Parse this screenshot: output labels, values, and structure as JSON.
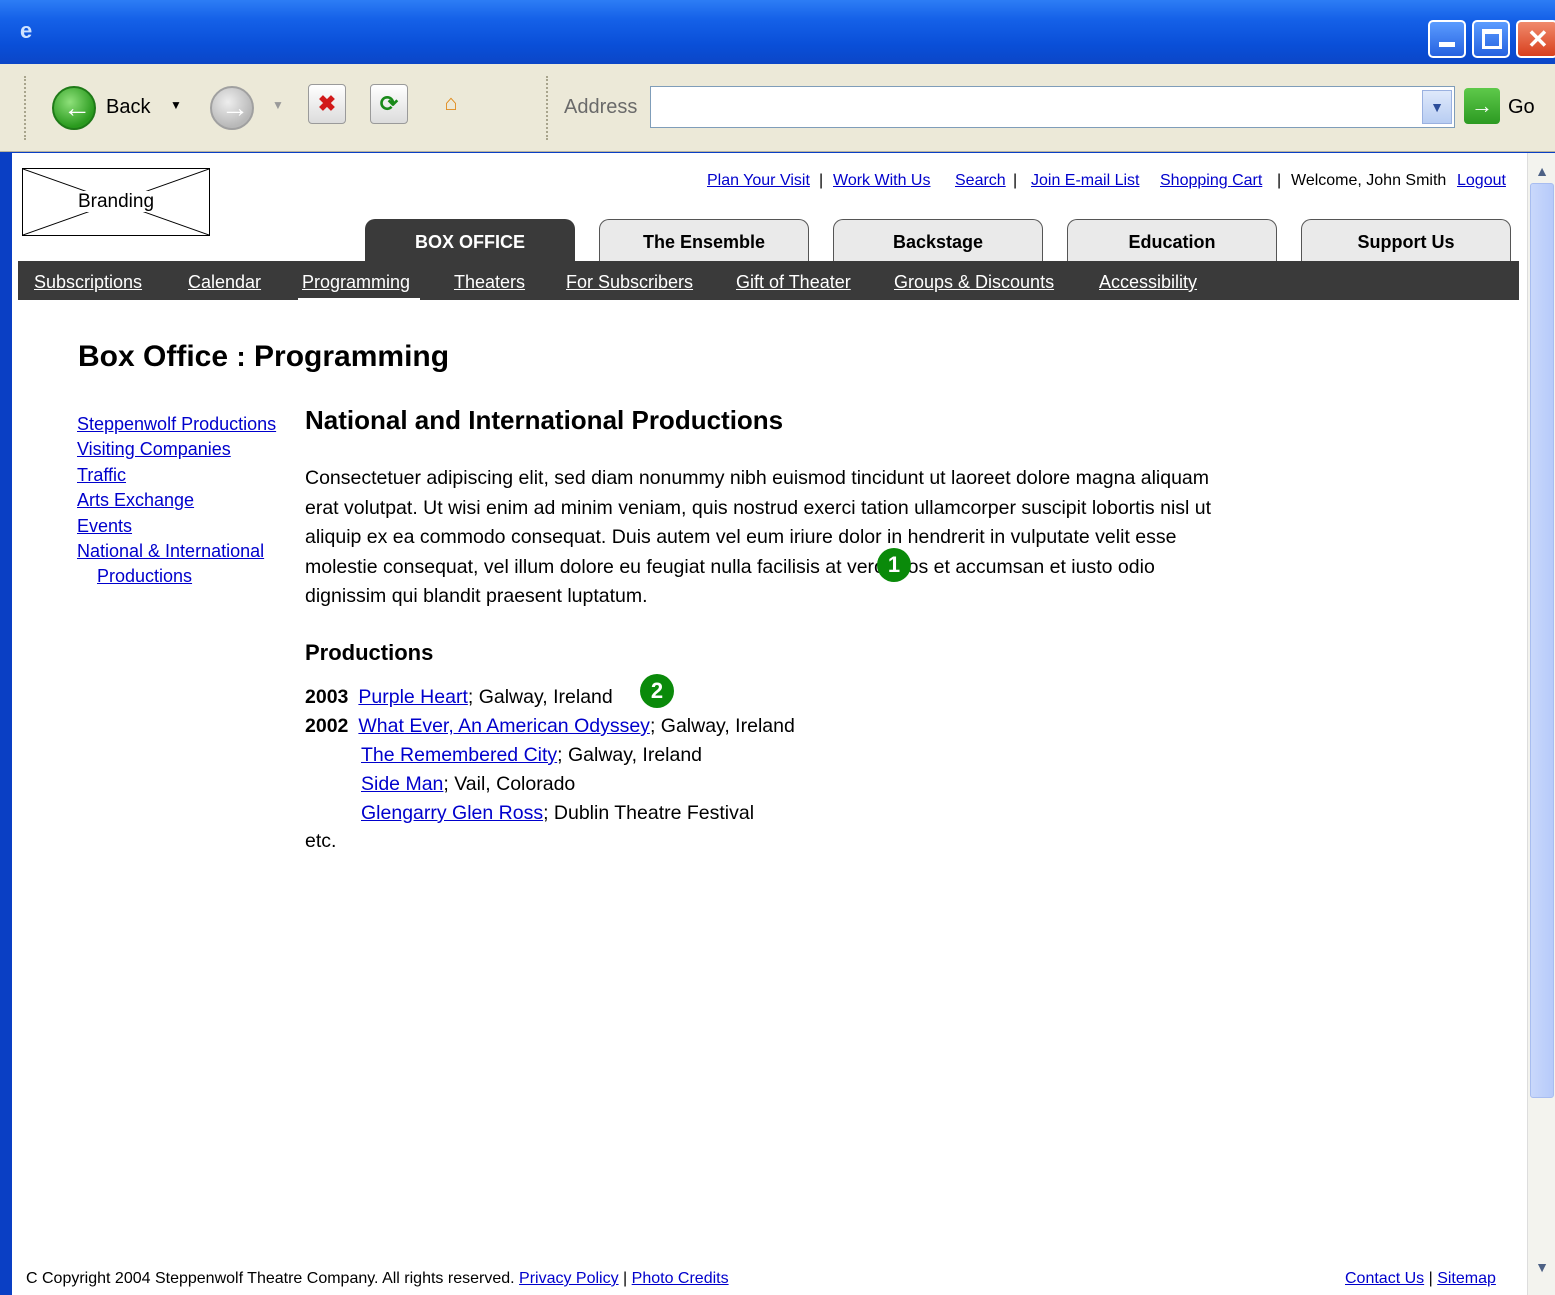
{
  "browser": {
    "toolbar": {
      "back_label": "Back",
      "address_label": "Address",
      "address_value": "",
      "go_label": "Go"
    }
  },
  "site": {
    "branding_label": "Branding",
    "utility_links": [
      "Plan Your Visit",
      "Work With Us",
      "Search",
      "Join E-mail List",
      "Shopping Cart"
    ],
    "utility_separator": "|",
    "welcome_text": "Welcome, John Smith",
    "logout_label": "Logout",
    "tabs": [
      "BOX OFFICE",
      "The Ensemble",
      "Backstage",
      "Education",
      "Support Us"
    ],
    "active_tab": "BOX OFFICE",
    "subnav": [
      "Subscriptions",
      "Calendar",
      "Programming",
      "Theaters",
      "For Subscribers",
      "Gift of Theater",
      "Groups & Discounts",
      "Accessibility"
    ],
    "active_subnav": "Programming"
  },
  "page": {
    "title_section": "Box Office",
    "title_sep": ":",
    "title_page": "Programming",
    "left_nav": [
      "Steppenwolf Productions",
      "Visiting Companies",
      "Traffic",
      "Arts Exchange",
      "Events",
      "National & International",
      "Productions"
    ],
    "section_title": "National and International Productions",
    "body_text": "Consectetuer adipiscing elit, sed diam nonummy nibh euismod tincidunt ut laoreet dolore magna aliquam erat volutpat. Ut wisi enim ad minim veniam, quis nostrud exerci tation ullamcorper suscipit lobortis nisl ut aliquip ex ea commodo consequat. Duis autem vel eum iriure dolor in hendrerit in vulputate velit esse molestie consequat, vel illum dolore eu feugiat nulla facilisis at vero eros et accumsan et iusto odio dignissim qui blandit praesent luptatum.",
    "productions_title": "Productions",
    "productions": [
      {
        "year": "2003",
        "title": "Purple Heart",
        "location": "; Galway, Ireland"
      },
      {
        "year": "2002",
        "title": "What Ever, An American Odyssey",
        "location": "; Galway, Ireland"
      },
      {
        "year": "",
        "title": "The Remembered City",
        "location": "; Galway, Ireland"
      },
      {
        "year": "",
        "title": "Side Man",
        "location": "; Vail, Colorado"
      },
      {
        "year": "",
        "title": "Glengarry Glen Ross",
        "location": "; Dublin Theatre Festival"
      }
    ],
    "etc": "etc.",
    "markers": [
      "1",
      "2"
    ]
  },
  "footer": {
    "copyright": "C Copyright 2004 Steppenwolf Theatre Company. All rights reserved.",
    "links_left": [
      "Privacy Policy",
      "Photo Credits"
    ],
    "links_right": [
      "Contact Us",
      "Sitemap"
    ],
    "separator": "|"
  }
}
